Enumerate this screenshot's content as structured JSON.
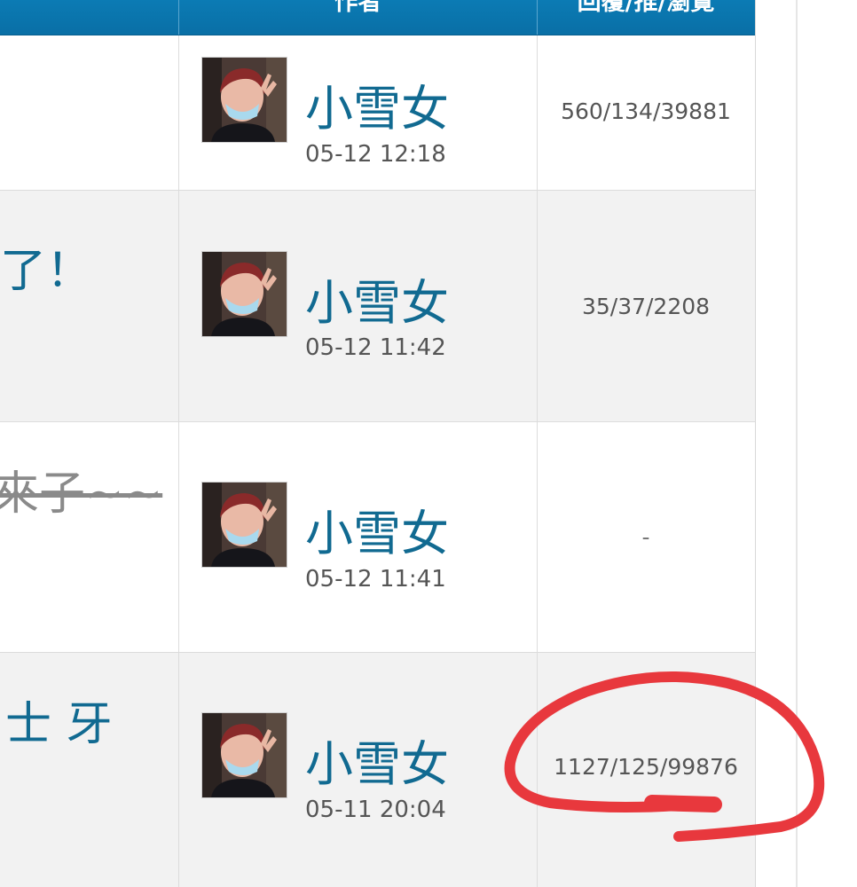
{
  "header": {
    "author_label": "作者",
    "stats_label": "回覆/推/瀏覽"
  },
  "threads": [
    {
      "title_fragment": "",
      "author": "小雪女",
      "date": "05-12 12:18",
      "stats": "560/134/39881",
      "strikethrough": false
    },
    {
      "title_fragment": "了！",
      "author": "小雪女",
      "date": "05-12 11:42",
      "stats": "35/37/2208",
      "strikethrough": false
    },
    {
      "title_fragment": "來子~~",
      "author": "小雪女",
      "date": "05-12 11:41",
      "stats": "-",
      "strikethrough": true
    },
    {
      "title_fragment": "士 牙",
      "author": "小雪女",
      "date": "05-11 20:04",
      "stats": "1127/125/99876",
      "strikethrough": false
    }
  ],
  "annotation": {
    "color": "#e8383d"
  }
}
